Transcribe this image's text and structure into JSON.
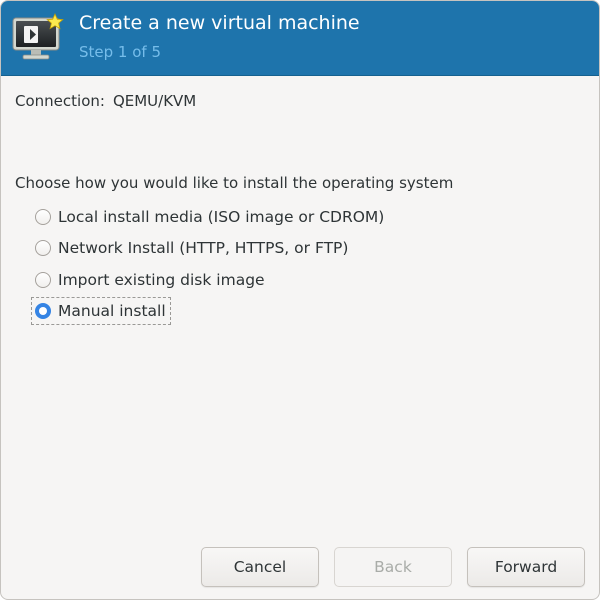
{
  "header": {
    "title": "Create a new virtual machine",
    "step": "Step 1 of 5"
  },
  "connection": {
    "label": "Connection:",
    "value": "QEMU/KVM"
  },
  "install": {
    "prompt": "Choose how you would like to install the operating system",
    "options": [
      {
        "label": "Local install media (ISO image or CDROM)",
        "selected": false
      },
      {
        "label": "Network Install (HTTP, HTTPS, or FTP)",
        "selected": false
      },
      {
        "label": "Import existing disk image",
        "selected": false
      },
      {
        "label": "Manual install",
        "selected": true
      }
    ]
  },
  "buttons": {
    "cancel": "Cancel",
    "back": "Back",
    "forward": "Forward"
  },
  "colors": {
    "header_bg": "#1e74ac",
    "header_step_text": "#76bdea",
    "radio_selected": "#3584e4",
    "window_bg": "#f6f5f4"
  },
  "icons": {
    "header": "virtual-machine-monitor-with-star-icon"
  }
}
